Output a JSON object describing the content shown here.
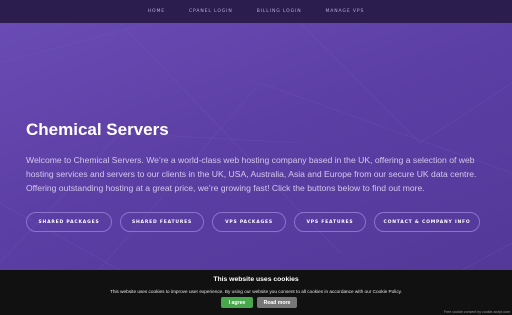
{
  "nav": {
    "items": [
      {
        "label": "HOME"
      },
      {
        "label": "CPANEL LOGIN"
      },
      {
        "label": "BILLING LOGIN"
      },
      {
        "label": "MANAGE VPS"
      }
    ]
  },
  "hero": {
    "title": "Chemical Servers",
    "text": "Welcome to Chemical Servers. We’re a world-class web hosting company based in the UK, offering a selection of web hosting services and servers to our clients in the UK, USA, Australia, Asia and Europe from our secure UK data centre. Offering outstanding hosting at a great price, we’re growing fast! Click the buttons below to find out more.",
    "buttons": [
      {
        "label": "SHARED PACKAGES"
      },
      {
        "label": "SHARED FEATURES"
      },
      {
        "label": "VPS PACKAGES"
      },
      {
        "label": "VPS FEATURES"
      },
      {
        "label": "CONTACT & COMPANY INFO"
      }
    ]
  },
  "cookie": {
    "title": "This website uses cookies",
    "text": "This website uses cookies to improve user experience. By using our website you consent to all cookies in accordance with our Cookie Policy.",
    "agree_label": "I agree",
    "readmore_label": "Read more",
    "attribution": "Free cookie consent by cookie-script.com"
  },
  "colors": {
    "nav_bg": "#2c1d4f",
    "hero_bg": "#5b3ea3",
    "cookie_bg": "#111111",
    "agree": "#4aa84c",
    "readmore": "#777777"
  }
}
